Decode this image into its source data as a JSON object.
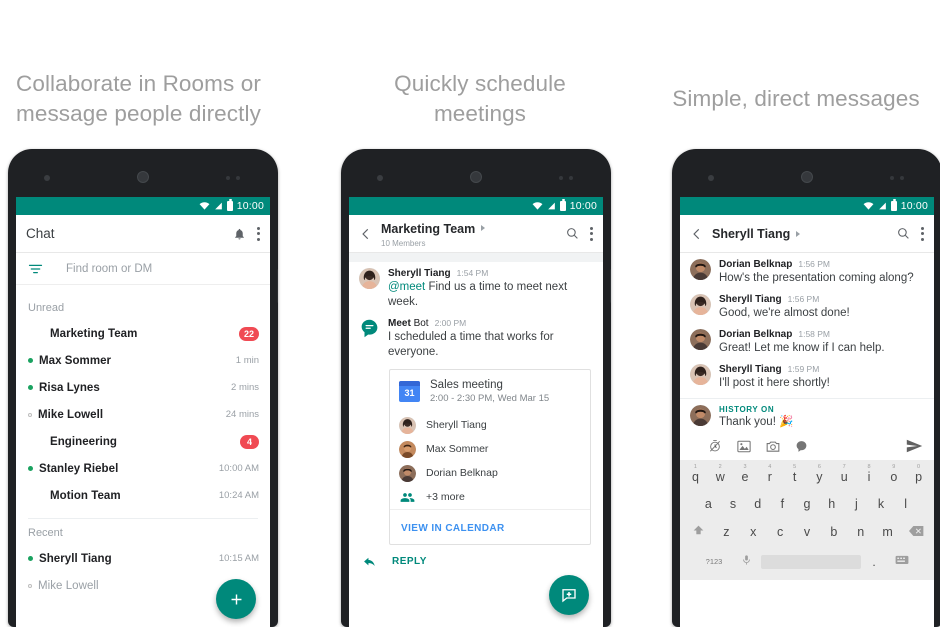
{
  "headings": {
    "one": "Collaborate in Rooms or\nmessage people directly",
    "two": "Quickly schedule\nmeetings",
    "three": "Simple, direct messages"
  },
  "colors": {
    "teal": "#00897B",
    "badge_red": "#F04A53",
    "link_blue": "#3d91f0",
    "calendar_blue": "#4285F4",
    "presence_green": "#1aa260",
    "heading_gray": "#9e9e9e"
  },
  "status_bar": {
    "time": "10:00",
    "icons": [
      "wifi-icon",
      "signal-icon",
      "battery-icon"
    ]
  },
  "phone1": {
    "appbar": {
      "title": "Chat",
      "icons": [
        "bell-icon",
        "overflow-menu-icon"
      ]
    },
    "search": {
      "placeholder": "Find room or DM",
      "filter_icon": "filter-icon"
    },
    "sections": [
      {
        "label": "Unread",
        "rows": [
          {
            "name": "Marketing Team",
            "presence": "none",
            "badge": "22",
            "time": ""
          },
          {
            "name": "Max Sommer",
            "presence": "online",
            "badge": "",
            "time": "1 min"
          },
          {
            "name": "Risa Lynes",
            "presence": "online",
            "badge": "",
            "time": "2 mins"
          },
          {
            "name": "Mike Lowell",
            "presence": "away",
            "badge": "",
            "time": "24 mins"
          },
          {
            "name": "Engineering",
            "presence": "none",
            "badge": "4",
            "time": ""
          },
          {
            "name": "Stanley Riebel",
            "presence": "online",
            "badge": "",
            "time": "10:00 AM"
          },
          {
            "name": "Motion Team",
            "presence": "none",
            "badge": "",
            "time": "10:24 AM"
          }
        ]
      },
      {
        "label": "Recent",
        "rows": [
          {
            "name": "Sheryll Tiang",
            "presence": "online",
            "badge": "",
            "time": "10:15 AM"
          },
          {
            "name": "Mike Lowell",
            "presence": "away",
            "badge": "",
            "time": "",
            "muted": true
          }
        ]
      }
    ],
    "fab": {
      "icon": "plus-icon",
      "label": "+"
    }
  },
  "phone2": {
    "appbar": {
      "back_icon": "back-chevron-icon",
      "title": "Marketing Team",
      "subtitle": "10 Members",
      "icons": [
        "search-icon",
        "overflow-menu-icon"
      ]
    },
    "messages": [
      {
        "author": "Sheryll Tiang",
        "author_suffix": "",
        "time": "1:54 PM",
        "mention": "@meet",
        "text": " Find us a time to meet next week.",
        "avatar": "avatar-sheryll"
      },
      {
        "author": "Meet",
        "author_suffix": "Bot",
        "time": "2:00 PM",
        "mention": "",
        "text": "I scheduled a time that works for everyone.",
        "avatar": "meet-bot-icon"
      }
    ],
    "card": {
      "calendar_icon_day": "31",
      "title": "Sales meeting",
      "subtitle": "2:00 - 2:30 PM, Wed Mar 15",
      "attendees": [
        {
          "name": "Sheryll Tiang",
          "avatar": "avatar-sheryll"
        },
        {
          "name": "Max Sommer",
          "avatar": "avatar-max"
        },
        {
          "name": "Dorian Belknap",
          "avatar": "avatar-dorian"
        }
      ],
      "more_label": "+3 more",
      "more_icon": "people-icon",
      "action_label": "VIEW IN CALENDAR"
    },
    "reply": {
      "icon": "reply-arrow-icon",
      "label": "REPLY"
    },
    "fab": {
      "icon": "new-message-icon"
    }
  },
  "phone3": {
    "appbar": {
      "back_icon": "back-chevron-icon",
      "title": "Sheryll Tiang",
      "icons": [
        "search-icon",
        "overflow-menu-icon"
      ]
    },
    "messages": [
      {
        "author": "Dorian Belknap",
        "time": "1:56 PM",
        "text": "How's the presentation coming along?",
        "avatar": "avatar-dorian"
      },
      {
        "author": "Sheryll Tiang",
        "time": "1:56 PM",
        "text": "Good, we're almost done!",
        "avatar": "avatar-sheryll"
      },
      {
        "author": "Dorian Belknap",
        "time": "1:58 PM",
        "text": "Great! Let me know if I can help.",
        "avatar": "avatar-dorian"
      },
      {
        "author": "Sheryll Tiang",
        "time": "1:59 PM",
        "text": "I'll post it here shortly!",
        "avatar": "avatar-sheryll"
      }
    ],
    "pending": {
      "history_label": "HISTORY ON",
      "text": "Thank you! 🎉",
      "avatar": "avatar-dorian"
    },
    "composer": {
      "icons": [
        "history-off-icon",
        "image-icon",
        "camera-icon",
        "sticker-icon"
      ],
      "send_icon": "send-icon"
    },
    "keyboard": {
      "row1": [
        {
          "k": "q",
          "n": "1"
        },
        {
          "k": "w",
          "n": "2"
        },
        {
          "k": "e",
          "n": "3"
        },
        {
          "k": "r",
          "n": "4"
        },
        {
          "k": "t",
          "n": "5"
        },
        {
          "k": "y",
          "n": "6"
        },
        {
          "k": "u",
          "n": "7"
        },
        {
          "k": "i",
          "n": "8"
        },
        {
          "k": "o",
          "n": "9"
        },
        {
          "k": "p",
          "n": "0"
        }
      ],
      "row2": [
        "a",
        "s",
        "d",
        "f",
        "g",
        "h",
        "j",
        "k",
        "l"
      ],
      "row3": [
        "z",
        "x",
        "c",
        "v",
        "b",
        "n",
        "m"
      ],
      "shift_icon": "shift-icon",
      "delete_icon": "backspace-icon",
      "sym_label": "?123",
      "mic_icon": "microphone-icon",
      "period": ".",
      "keyboard_icon": "keyboard-switch-icon"
    }
  }
}
